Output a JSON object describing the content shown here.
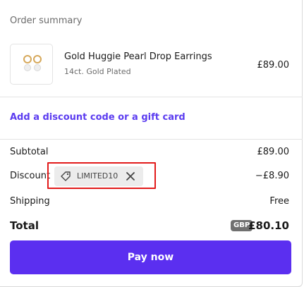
{
  "summary": {
    "title": "Order summary"
  },
  "product": {
    "name": "Gold Huggie Pearl Drop Earrings",
    "variant": "14ct. Gold Plated",
    "price": "£89.00"
  },
  "discount_link": "Add a discount code or a gift card",
  "totals": {
    "subtotal_label": "Subtotal",
    "subtotal_value": "£89.00",
    "discount_label": "Discount",
    "discount_code": "LIMITED10",
    "discount_value": "−£8.90",
    "shipping_label": "Shipping",
    "shipping_value": "Free",
    "total_label": "Total",
    "currency": "GBP",
    "total_value": "£80.10"
  },
  "pay_button": "Pay now",
  "colors": {
    "accent": "#5b2ff0",
    "link": "#5b3cf0",
    "highlight": "#e21b1b"
  }
}
